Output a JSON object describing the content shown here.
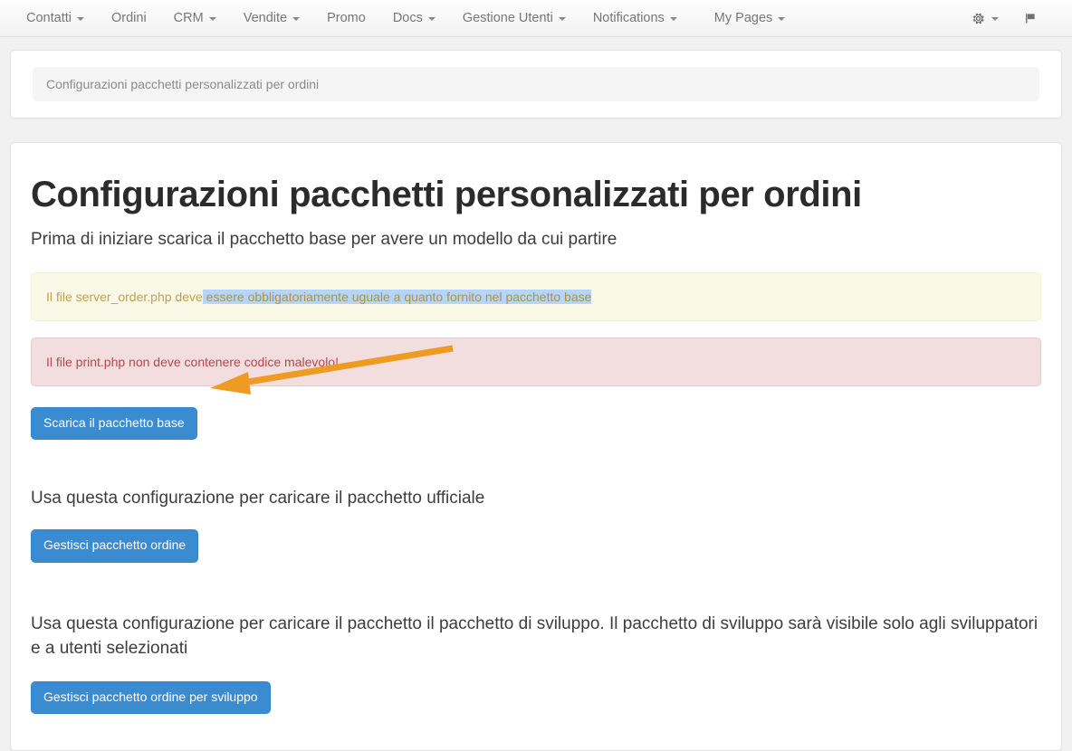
{
  "navbar": {
    "items": [
      {
        "label": "Contatti",
        "has_caret": true
      },
      {
        "label": "Ordini",
        "has_caret": false
      },
      {
        "label": "CRM",
        "has_caret": true
      },
      {
        "label": "Vendite",
        "has_caret": true
      },
      {
        "label": "Promo",
        "has_caret": false
      },
      {
        "label": "Docs",
        "has_caret": true
      },
      {
        "label": "Gestione Utenti",
        "has_caret": true
      },
      {
        "label": "Notifications",
        "has_caret": true
      },
      {
        "label": "My Pages",
        "has_caret": true
      }
    ],
    "settings_icon": "gear-icon",
    "flag_icon": "flag-icon"
  },
  "breadcrumb": {
    "text": "Configurazioni pacchetti personalizzati per ordini"
  },
  "main": {
    "title": "Configurazioni pacchetti personalizzati per ordini",
    "subtitle": "Prima di iniziare scarica il pacchetto base per avere un modello da cui partire",
    "alert_warning": {
      "prefix": "Il file server_order.php deve",
      "selected": " essere obbligatoriamente uguale a quanto fornito nel pacchetto base"
    },
    "alert_danger": {
      "text": "Il file print.php non deve contenere codice malevolo!"
    },
    "download_button": "Scarica il pacchetto base",
    "sections": [
      {
        "text": "Usa questa configurazione per caricare il pacchetto ufficiale",
        "button": "Gestisci pacchetto ordine"
      },
      {
        "text": "Usa questa configurazione per caricare il pacchetto il pacchetto di sviluppo. Il pacchetto di sviluppo sarà visibile solo agli sviluppatori e a utenti selezionati",
        "button": "Gestisci pacchetto ordine per sviluppo"
      }
    ]
  },
  "annotation": {
    "arrow_color": "#ef9a23",
    "arrow_name": "orange-pointer-arrow"
  },
  "colors": {
    "primary_button": "#3b8bd0",
    "warning_bg": "#faf8e6",
    "danger_bg": "#f2dede",
    "selection": "#b4d5fe",
    "page_bg": "#f1f1f1"
  }
}
